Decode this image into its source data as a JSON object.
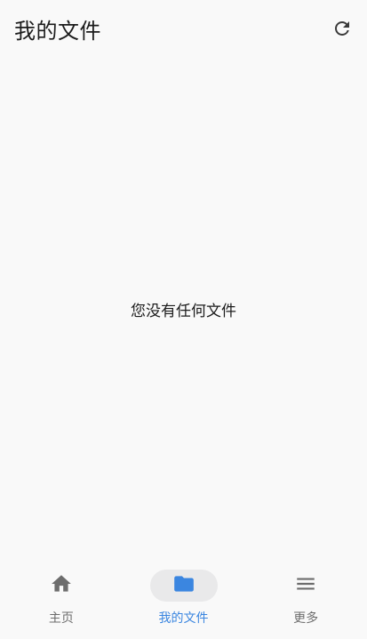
{
  "header": {
    "title": "我的文件",
    "refresh_icon": "refresh-icon"
  },
  "main": {
    "empty_message": "您没有任何文件"
  },
  "bottom_nav": {
    "active_color": "#3b86e0",
    "inactive_color": "#6d6d6d",
    "items": [
      {
        "label": "主页",
        "icon": "home-icon",
        "active": false
      },
      {
        "label": "我的文件",
        "icon": "folder-icon",
        "active": true
      },
      {
        "label": "更多",
        "icon": "menu-icon",
        "active": false
      }
    ]
  }
}
